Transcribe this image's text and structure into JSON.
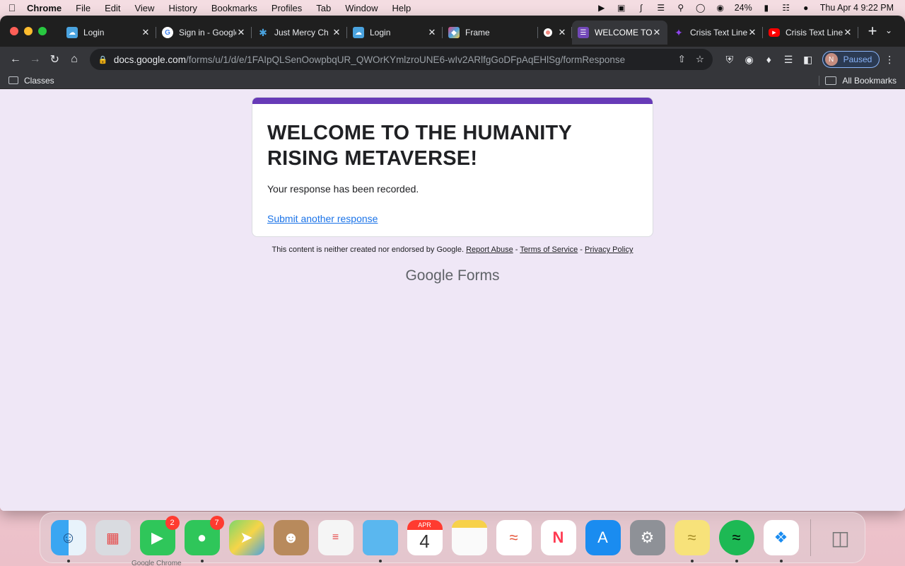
{
  "menubar": {
    "app": "Chrome",
    "items": [
      "File",
      "Edit",
      "View",
      "History",
      "Bookmarks",
      "Profiles",
      "Tab",
      "Window",
      "Help"
    ],
    "battery": "24%",
    "clock": "Thu Apr 4  9:22 PM"
  },
  "tabs": [
    {
      "title": "Login",
      "favicon_color": "#4aa3df",
      "favicon": "cloud-icon"
    },
    {
      "title": "Sign in - Google",
      "favicon_color": "#ffffff",
      "favicon": "google-icon"
    },
    {
      "title": "Just Mercy Ch",
      "favicon_color": "#1f1f1f",
      "favicon": "asterisk-icon"
    },
    {
      "title": "Login",
      "favicon_color": "#4aa3df",
      "favicon": "cloud-icon"
    },
    {
      "title": "Frame",
      "favicon_color": "#e0467c",
      "favicon": "cube-icon"
    },
    {
      "title": "",
      "favicon_color": "#ea4335",
      "favicon": "record-icon"
    },
    {
      "title": "WELCOME TO",
      "favicon_color": "#7248b9",
      "favicon": "forms-icon",
      "active": true
    },
    {
      "title": "Crisis Text Line",
      "favicon_color": "#6c2bd9",
      "favicon": "crisis-icon"
    },
    {
      "title": "Crisis Text Line",
      "favicon_color": "#ff0000",
      "favicon": "youtube-icon"
    }
  ],
  "address": {
    "host": "docs.google.com",
    "path": "/forms/u/1/d/e/1FAIpQLSenOowpbqUR_QWOrKYmlzroUNE6-wIv2ARlfgGoDFpAqEHlSg/formResponse"
  },
  "profile": {
    "initial": "N",
    "label": "Paused"
  },
  "bookmarks": {
    "folder": "Classes",
    "all": "All Bookmarks"
  },
  "form": {
    "accent": "#673ab7",
    "title": "WELCOME TO THE HUMANITY RISING METAVERSE!",
    "confirmation": "Your response has been recorded.",
    "link": "Submit another response"
  },
  "footer": {
    "note": "This content is neither created nor endorsed by Google.",
    "report": "Report Abuse",
    "terms": "Terms of Service",
    "privacy": "Privacy Policy",
    "sep": " - ",
    "brand_google": "Google",
    "brand_forms": "Forms"
  },
  "dock": {
    "facetime_badge": "2",
    "messages_badge": "7",
    "calendar_month": "APR",
    "calendar_day": "4",
    "tooltip": "Google Chrome"
  }
}
